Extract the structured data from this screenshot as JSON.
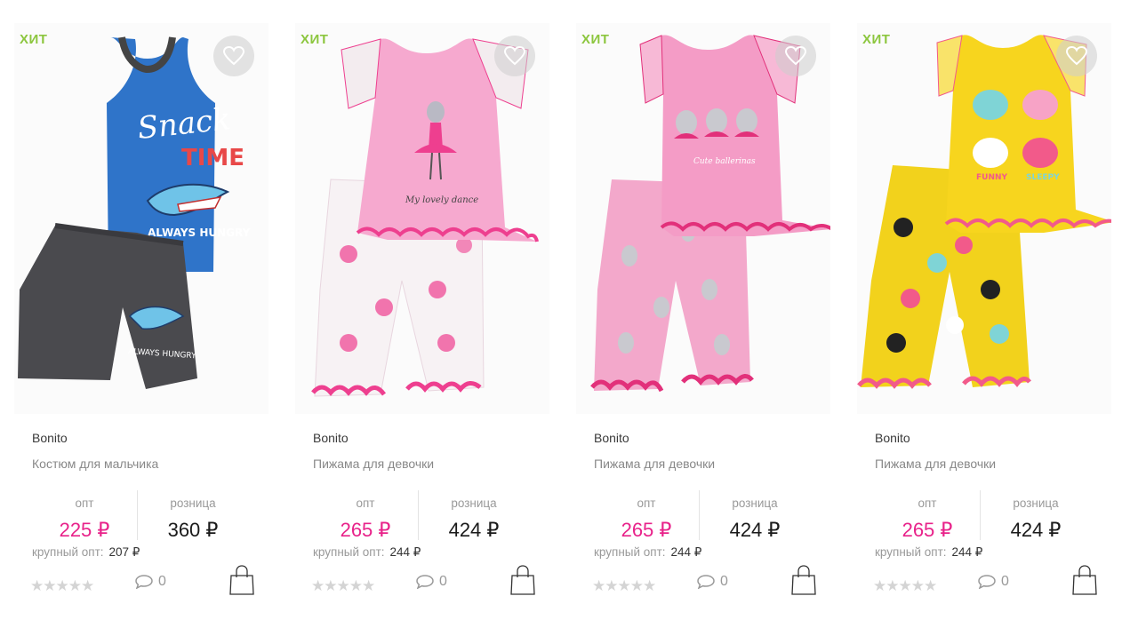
{
  "products": [
    {
      "badge": "ХИТ",
      "brand": "Bonito",
      "name": "Костюм для мальчика",
      "opt_label": "опт",
      "opt_price": "225 ₽",
      "retail_label": "розница",
      "retail_price": "360 ₽",
      "bulk_label": "крупный опт:",
      "bulk_price": "207 ₽",
      "rating": 0,
      "stars": "★★★★★",
      "comments": "0",
      "image_desc": "blue-tank-grey-shorts-shark-print",
      "colors": {
        "top": "#2f74c9",
        "bottom": "#4a4a4e",
        "accent": "#e23a3a"
      }
    },
    {
      "badge": "ХИТ",
      "brand": "Bonito",
      "name": "Пижама для девочки",
      "opt_label": "опт",
      "opt_price": "265 ₽",
      "retail_label": "розница",
      "retail_price": "424 ₽",
      "bulk_label": "крупный опт:",
      "bulk_price": "244 ₽",
      "rating": 0,
      "stars": "★★★★★",
      "comments": "0",
      "image_desc": "pink-top-white-ballerina-pants",
      "colors": {
        "top": "#f6a9cf",
        "bottom": "#f7f2f4",
        "accent": "#ee3f8f"
      }
    },
    {
      "badge": "ХИТ",
      "brand": "Bonito",
      "name": "Пижама для девочки",
      "opt_label": "опт",
      "opt_price": "265 ₽",
      "retail_label": "розница",
      "retail_price": "424 ₽",
      "bulk_label": "крупный опт:",
      "bulk_price": "244 ₽",
      "rating": 0,
      "stars": "★★★★★",
      "comments": "0",
      "image_desc": "pink-top-pink-bunny-pants",
      "colors": {
        "top": "#f49cc6",
        "bottom": "#f3a8cb",
        "accent": "#e2307a"
      }
    },
    {
      "badge": "ХИТ",
      "brand": "Bonito",
      "name": "Пижама для девочки",
      "opt_label": "опт",
      "opt_price": "265 ₽",
      "retail_label": "розница",
      "retail_price": "424 ₽",
      "bulk_label": "крупный опт:",
      "bulk_price": "244 ₽",
      "rating": 0,
      "stars": "★★★★★",
      "comments": "0",
      "image_desc": "yellow-top-yellow-cat-pants",
      "colors": {
        "top": "#f7d51e",
        "bottom": "#f2d21c",
        "accent": "#f25a8a"
      }
    }
  ],
  "icons": {
    "favorite": "heart-icon",
    "comments": "comment-bubble-icon",
    "cart": "shopping-bag-icon",
    "rating": "star-icon"
  },
  "theme": {
    "badge_color": "#8cc63e",
    "opt_price_color": "#e8228a",
    "retail_price_color": "#1a1a1a"
  }
}
